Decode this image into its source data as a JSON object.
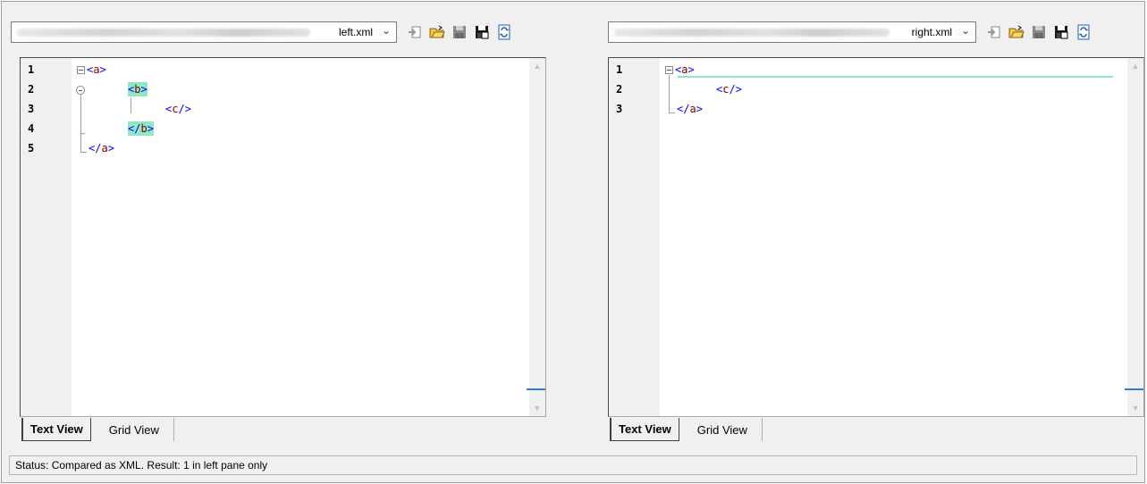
{
  "left": {
    "file": "left.xml",
    "line_numbers": [
      "1",
      "2",
      "3",
      "4",
      "5"
    ],
    "lines": [
      {
        "text": "<a>",
        "tag": "a",
        "diff": false
      },
      {
        "text": "<b>",
        "tag": "b",
        "diff": true
      },
      {
        "text": "<c/>",
        "tag": "c",
        "diff": false
      },
      {
        "text": "</b>",
        "tag": "b",
        "diff": true
      },
      {
        "text": "</a>",
        "tag": "a",
        "diff": false
      }
    ],
    "tabs": [
      "Text View",
      "Grid View"
    ]
  },
  "right": {
    "file": "right.xml",
    "line_numbers": [
      "1",
      "2",
      "3"
    ],
    "lines": [
      {
        "text": "<a>",
        "tag": "a",
        "diff": false
      },
      {
        "text": "<c/>",
        "tag": "c",
        "diff": false
      },
      {
        "text": "</a>",
        "tag": "a",
        "diff": false
      }
    ],
    "tabs": [
      "Text View",
      "Grid View"
    ]
  },
  "toolbar_icons": [
    "import-icon",
    "open-folder-icon",
    "save-icon",
    "save-as-icon",
    "refresh-icon"
  ],
  "colors": {
    "diff_highlight": "#8fe8c2",
    "tag_bracket": "#0000ff",
    "tag_name": "#800000",
    "scroll_marker": "#2a7fd4"
  },
  "status": "Status: Compared as XML. Result: 1 in left pane only"
}
